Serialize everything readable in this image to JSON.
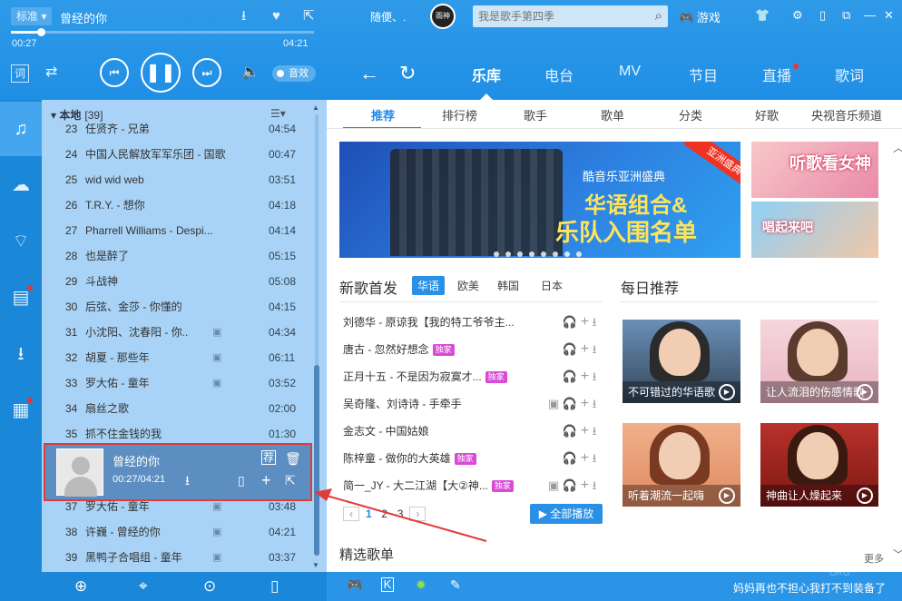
{
  "player": {
    "quality": "标准",
    "song_title": "曾经的你",
    "elapsed": "00:27",
    "total": "04:21",
    "progress_fraction": 0.1,
    "lyric_label": "词",
    "effect_label": "音效"
  },
  "topbar": {
    "random_label": "随便、.",
    "avatar_text": "雨神",
    "search_placeholder": "我是歌手第四季",
    "game_label": "游戏"
  },
  "main_tabs": [
    {
      "label": "乐库",
      "active": true
    },
    {
      "label": "电台"
    },
    {
      "label": "MV"
    },
    {
      "label": "节目"
    },
    {
      "label": "直播",
      "badge": true
    },
    {
      "label": "歌词"
    }
  ],
  "sub_tabs": [
    "推荐",
    "排行榜",
    "歌手",
    "歌单",
    "分类",
    "好歌",
    "央视音乐频道"
  ],
  "playlist": {
    "title": "本地",
    "count": "[39]",
    "rows": [
      {
        "no": "23",
        "name": "任贤齐 - 兄弟",
        "dur": "04:54",
        "mv": false
      },
      {
        "no": "24",
        "name": "中国人民解放军军乐团 - 国歌",
        "dur": "00:47",
        "mv": false
      },
      {
        "no": "25",
        "name": "wid wid web",
        "dur": "03:51",
        "mv": false
      },
      {
        "no": "26",
        "name": "T.R.Y. - 想你",
        "dur": "04:18",
        "mv": false
      },
      {
        "no": "27",
        "name": "Pharrell Williams - Despi...",
        "dur": "04:14",
        "mv": false
      },
      {
        "no": "28",
        "name": "也是醉了",
        "dur": "05:15",
        "mv": false
      },
      {
        "no": "29",
        "name": "斗战神",
        "dur": "05:08",
        "mv": false
      },
      {
        "no": "30",
        "name": "后弦、金莎 - 你懂的",
        "dur": "04:15",
        "mv": false
      },
      {
        "no": "31",
        "name": "小沈阳、沈春阳 - 你..",
        "dur": "04:34",
        "mv": true
      },
      {
        "no": "32",
        "name": "胡夏 - 那些年",
        "dur": "06:11",
        "mv": true
      },
      {
        "no": "33",
        "name": "罗大佑 - 童年",
        "dur": "03:52",
        "mv": true
      },
      {
        "no": "34",
        "name": "扇丝之歌",
        "dur": "02:00",
        "mv": false
      },
      {
        "no": "35",
        "name": "抓不住金钱的我",
        "dur": "01:30",
        "mv": false
      },
      {
        "no": "37",
        "name": "罗大佑 - 童年",
        "dur": "03:48",
        "mv": true
      },
      {
        "no": "38",
        "name": "许巍 - 曾经的你",
        "dur": "04:21",
        "mv": true
      },
      {
        "no": "39",
        "name": "黑鸭子合唱组 - 童年",
        "dur": "03:37",
        "mv": true
      }
    ],
    "now_playing": {
      "title": "曾经的你",
      "time": "00:27/04:21"
    },
    "scroll_fraction": 0.6
  },
  "banner": {
    "line1": "酷音乐亚洲盛典",
    "line2": "华语组合&",
    "line3": "乐队入围名单",
    "ribbon": "亚洲盛典"
  },
  "promos": [
    "听歌看女神",
    "唱起来吧"
  ],
  "new_songs": {
    "heading": "新歌首发",
    "langs": [
      "华语",
      "欧美",
      "韩国",
      "日本"
    ],
    "exclusive_label": "独家",
    "rows": [
      {
        "name": "刘德华 - 原谅我【我的特工爷爷主...",
        "excl": false,
        "mv": false
      },
      {
        "name": "唐古 - 忽然好想念",
        "excl": true,
        "mv": false
      },
      {
        "name": "正月十五 - 不是因为寂寞才...",
        "excl": true,
        "mv": false
      },
      {
        "name": "吴奇隆、刘诗诗 - 手牵手",
        "excl": false,
        "mv": true
      },
      {
        "name": "金志文 - 中国姑娘",
        "excl": false,
        "mv": false
      },
      {
        "name": "陈梓童 - 做你的大英雄",
        "excl": true,
        "mv": false
      },
      {
        "name": "简一_JY - 大二江湖【大②神...",
        "excl": true,
        "mv": true
      }
    ],
    "pages": [
      "1",
      "2",
      "3"
    ],
    "play_all": "全部播放"
  },
  "daily": {
    "heading": "每日推荐",
    "cards": [
      {
        "caption": "不可错过的华语歌"
      },
      {
        "caption": "让人流泪的伤感情歌"
      },
      {
        "caption": "听着潮流一起嗨"
      },
      {
        "caption": "神曲让人燥起来"
      }
    ]
  },
  "featured": {
    "heading": "精选歌单",
    "more": "更多"
  },
  "status": {
    "ticker": "妈妈再也不担心我打不到装备了",
    "watermark": "ORG"
  },
  "colors": {
    "accent": "#1f8ae6",
    "highlight_border": "#e23b3b",
    "exclusive": "#d94ad6"
  }
}
